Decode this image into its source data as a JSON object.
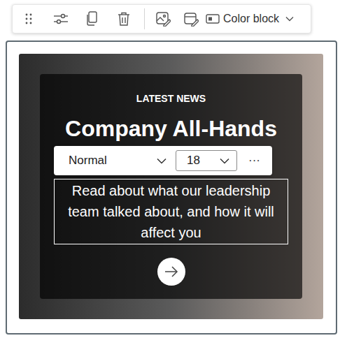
{
  "toolbar": {
    "color_block": {
      "label": "Color block"
    }
  },
  "card": {
    "eyebrow": "LATEST NEWS",
    "title": "Company All-Hands",
    "description": "Read about what our leadership team talked about, and how it will affect you"
  },
  "format_toolbar": {
    "style": "Normal",
    "size": "18",
    "more": "···"
  }
}
